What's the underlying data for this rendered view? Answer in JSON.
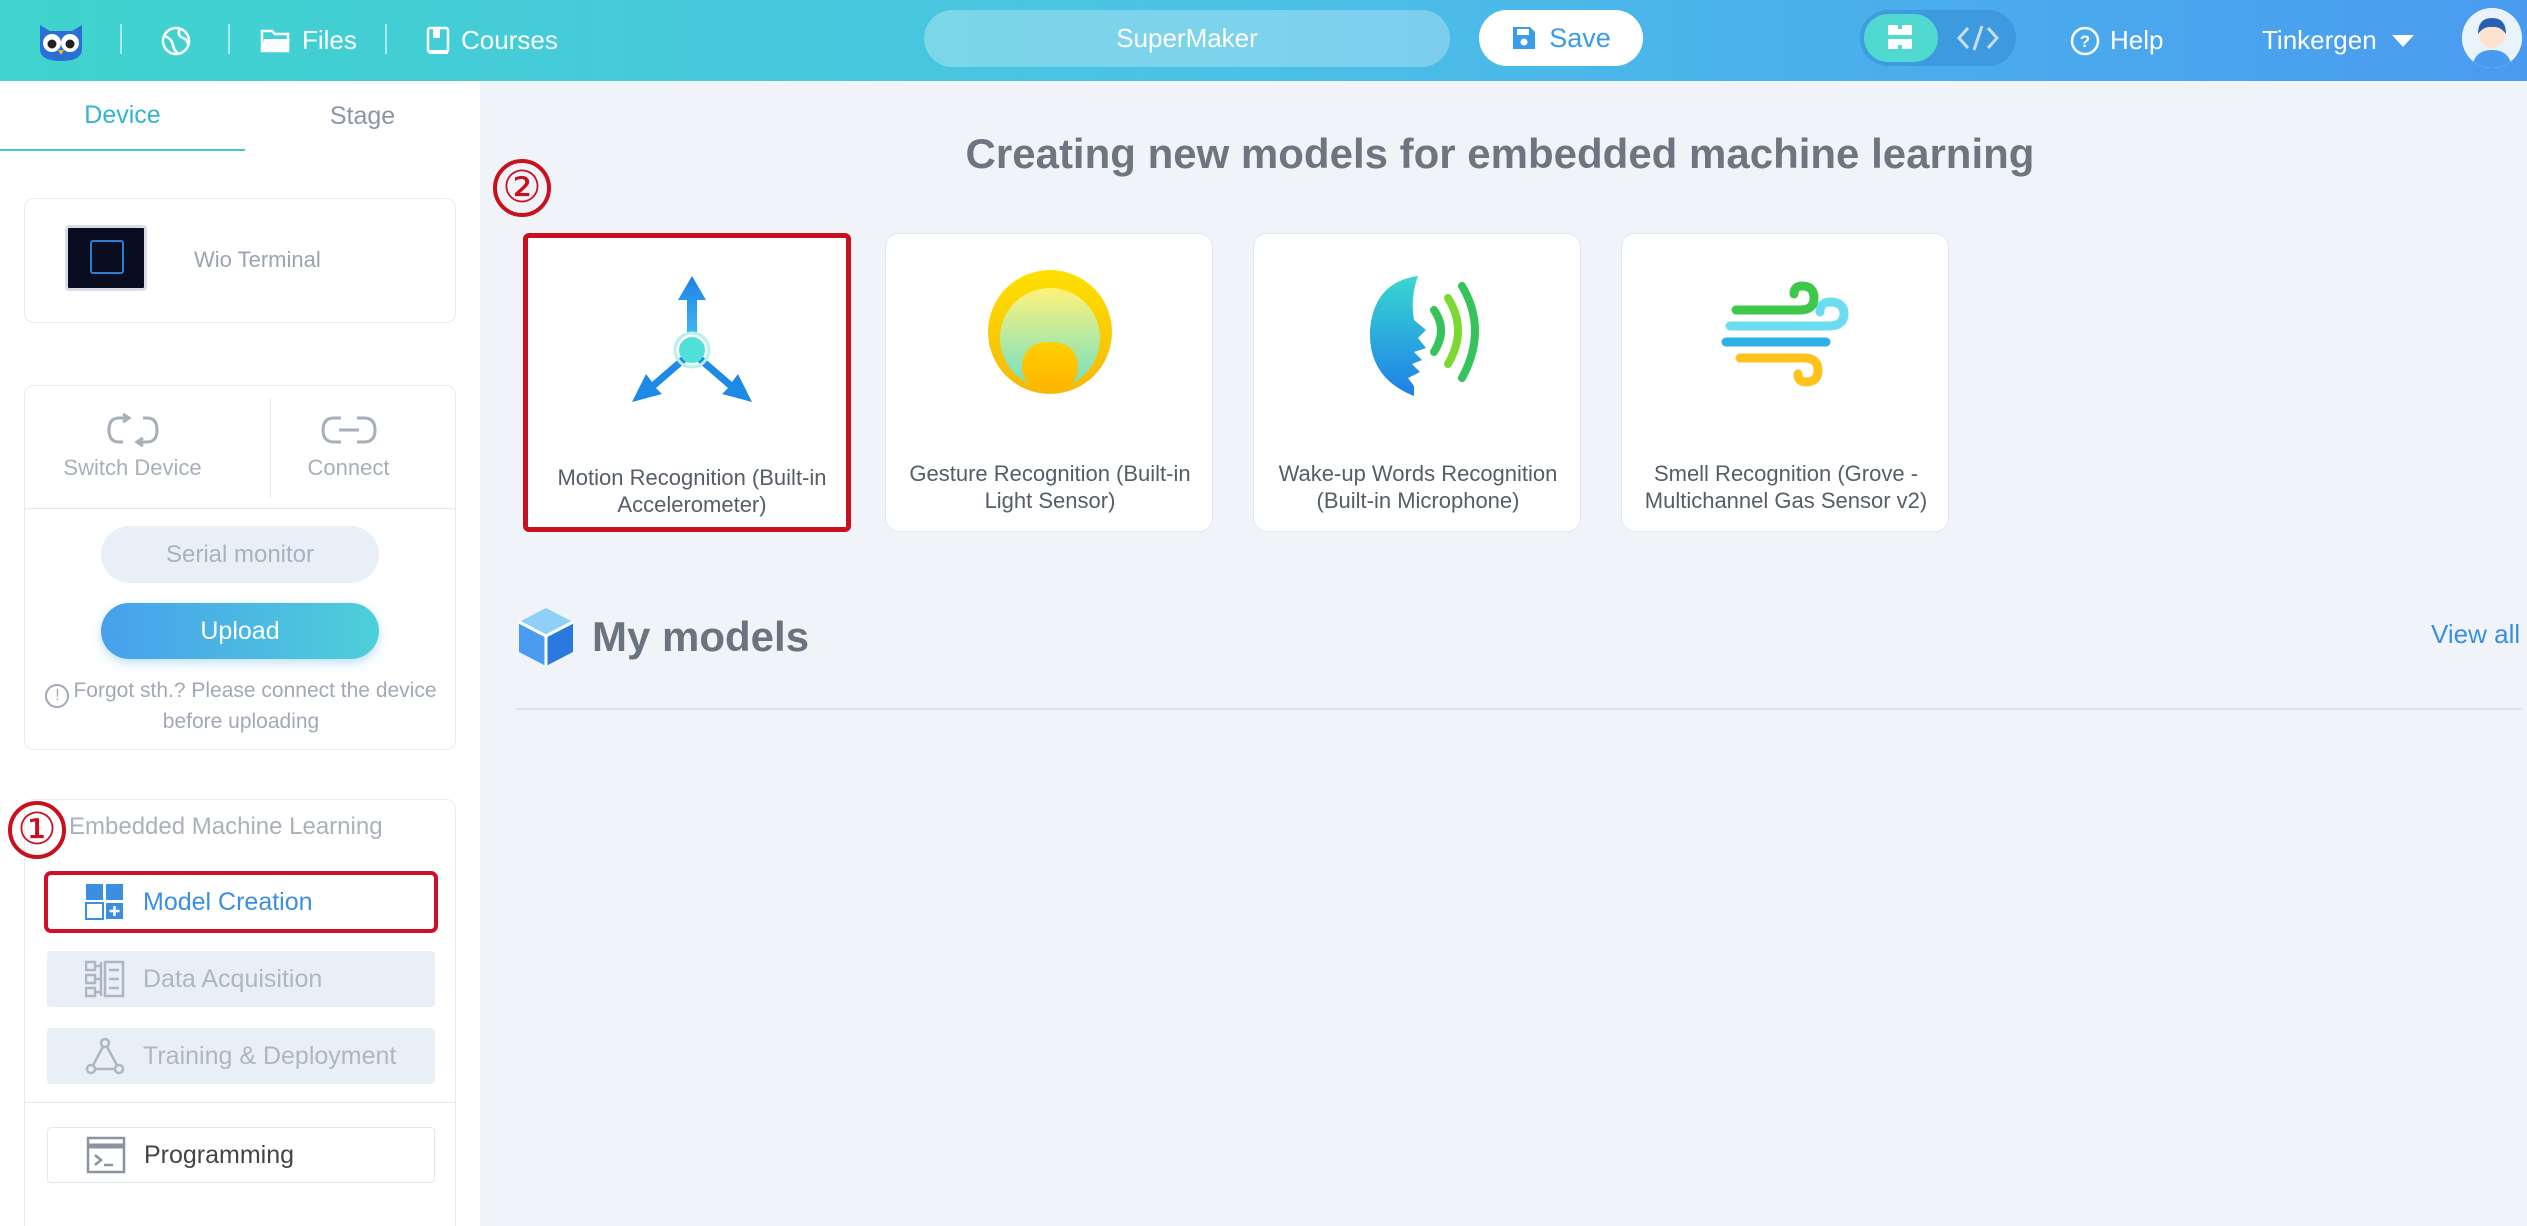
{
  "topbar": {
    "files_label": "Files",
    "courses_label": "Courses",
    "project_name": "SuperMaker",
    "save_label": "Save",
    "help_label": "Help",
    "user_name": "Tinkergen",
    "icons": [
      "owl-logo-icon",
      "globe-icon",
      "folder-icon",
      "book-icon",
      "save-icon",
      "block-mode-icon",
      "code-mode-icon",
      "help-icon",
      "chevron-down-icon",
      "avatar"
    ]
  },
  "sidebar": {
    "tabs": [
      {
        "label": "Device"
      },
      {
        "label": "Stage"
      }
    ],
    "device": {
      "name": "Wio Terminal"
    },
    "controls": {
      "switch_label": "Switch Device",
      "connect_label": "Connect",
      "serial_label": "Serial monitor",
      "upload_label": "Upload",
      "hint": "Forgot sth.? Please connect the device before uploading"
    },
    "eml": {
      "title": "Embedded Machine Learning",
      "items": [
        {
          "label": "Model Creation"
        },
        {
          "label": "Data Acquisition"
        },
        {
          "label": "Training & Deployment"
        },
        {
          "label": "Programming"
        }
      ]
    }
  },
  "annotations": {
    "marker1": "①",
    "marker2": "②",
    "highlight_color": "#c8101f"
  },
  "main": {
    "heading": "Creating new models for embedded machine learning",
    "model_cards": [
      {
        "label": "Motion Recognition (Built-in Accelerometer)",
        "icon": "motion-icon"
      },
      {
        "label": "Gesture Recognition (Built-in Light Sensor)",
        "icon": "gesture-icon"
      },
      {
        "label": "Wake-up Words Recognition (Built-in Microphone)",
        "icon": "wake-word-icon"
      },
      {
        "label": "Smell Recognition (Grove - Multichannel Gas Sensor v2)",
        "icon": "smell-icon"
      }
    ],
    "my_models_title": "My models",
    "view_all_label": "View all"
  },
  "colors": {
    "accent": "#3a9be8",
    "teal": "#49c5d1",
    "annotation_red": "#c8101f"
  }
}
